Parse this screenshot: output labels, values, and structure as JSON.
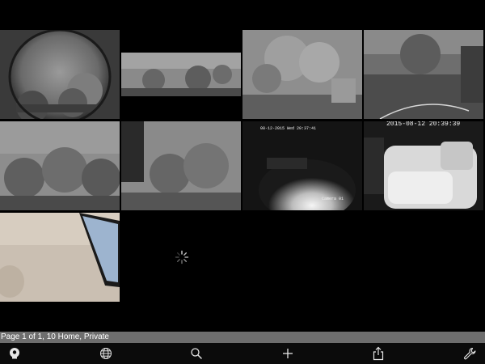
{
  "grid": {
    "cameras": [
      {
        "id": "cam-1",
        "kind": "fisheye-outdoor"
      },
      {
        "id": "cam-2",
        "kind": "wide-outdoor"
      },
      {
        "id": "cam-3",
        "kind": "trees-outdoor"
      },
      {
        "id": "cam-4",
        "kind": "yard-outdoor"
      },
      {
        "id": "cam-5",
        "kind": "trees-outdoor"
      },
      {
        "id": "cam-6",
        "kind": "trees-outdoor"
      },
      {
        "id": "cam-7",
        "kind": "night-room",
        "timestamp": "08-12-2015 Wed 20:37:41",
        "label": "Camera 01"
      },
      {
        "id": "cam-8",
        "kind": "night-room",
        "timestamp": "2015-08-12 20:39:39"
      },
      {
        "id": "cam-9",
        "kind": "indoor-tv"
      }
    ],
    "loading": true
  },
  "status": {
    "text": "Page 1 of 1, 10 Home, Private"
  },
  "toolbar": {
    "items": [
      {
        "icon": "location-pin-icon"
      },
      {
        "icon": "globe-icon"
      },
      {
        "icon": "search-icon"
      },
      {
        "icon": "plus-icon"
      },
      {
        "icon": "share-icon"
      },
      {
        "icon": "wrench-icon"
      }
    ]
  },
  "colors": {
    "background": "#000000",
    "status_bar": "#6e6e6e",
    "toolbar": "#0b0b0b",
    "icon": "#e6e6e6"
  }
}
